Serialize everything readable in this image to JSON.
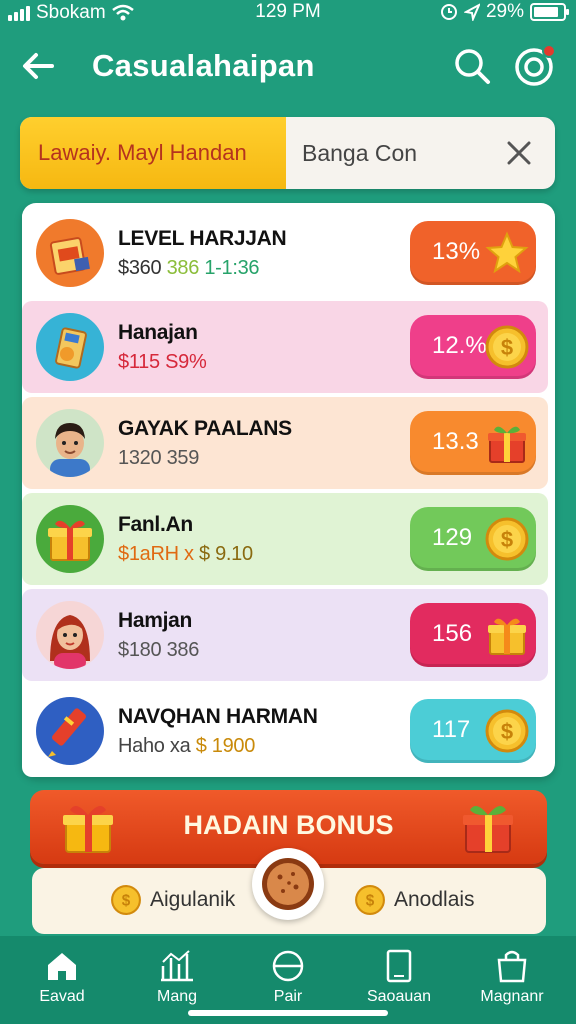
{
  "status_bar": {
    "carrier": "Sbokam",
    "time": "129 PM",
    "battery": "29%"
  },
  "header": {
    "title": "Casualahaipan"
  },
  "filter": {
    "active_tab": "Lawaiy. Mayl Handan",
    "second_tab": "Banga Con"
  },
  "rows": [
    {
      "name": "LEVEL HARJJAN",
      "sub_a": "$360",
      "sub_b": "386",
      "sub_c": "1-1:36",
      "value": "13%",
      "icon": "star-icon",
      "avatar": "ticket-icon"
    },
    {
      "name": "Hanajan",
      "sub_a": "$115",
      "sub_b": "S9%",
      "value": "12.%",
      "icon": "coin-icon",
      "avatar": "ticket-icon"
    },
    {
      "name": "GAYAK PAALANS",
      "sub_a": "1320",
      "sub_b": "359",
      "value": "13.3",
      "icon": "gift-icon",
      "avatar": "man-avatar"
    },
    {
      "name": "Fanl.An",
      "sub_a": "$1aRH x",
      "sub_b": "$ 9.10",
      "value": "129",
      "icon": "coin-icon",
      "avatar": "gift-icon"
    },
    {
      "name": "Hamjan",
      "sub_a": "$180",
      "sub_b": "386",
      "value": "156",
      "icon": "gift-icon",
      "avatar": "woman-avatar"
    },
    {
      "name": "NAVQHAN HARMAN",
      "sub_a": "Haho",
      "sub_b": "xa",
      "sub_c": "$ 1900",
      "value": "117",
      "icon": "coin-icon",
      "avatar": "crayon-icon"
    }
  ],
  "bonus": {
    "title": "HADAIN BONUS",
    "left_label": "Aigulanik",
    "right_label": "Anodlais"
  },
  "nav": [
    {
      "label": "Eavad",
      "icon": "home-icon"
    },
    {
      "label": "Mang",
      "icon": "chart-icon"
    },
    {
      "label": "Pair",
      "icon": "compass-icon"
    },
    {
      "label": "Saoauan",
      "icon": "card-icon"
    },
    {
      "label": "Magnanr",
      "icon": "bag-icon"
    }
  ],
  "colors": {
    "background": "#1f9d7d",
    "accent_yellow": "#f6b811",
    "bonus_orange": "#e04a1c",
    "pill_orange": "#f0622a",
    "pill_pink": "#ef3f8a",
    "pill_amber": "#f88a2e",
    "pill_green": "#72c95a",
    "pill_crimson": "#e22b5f",
    "pill_cyan": "#4ccdd6"
  }
}
